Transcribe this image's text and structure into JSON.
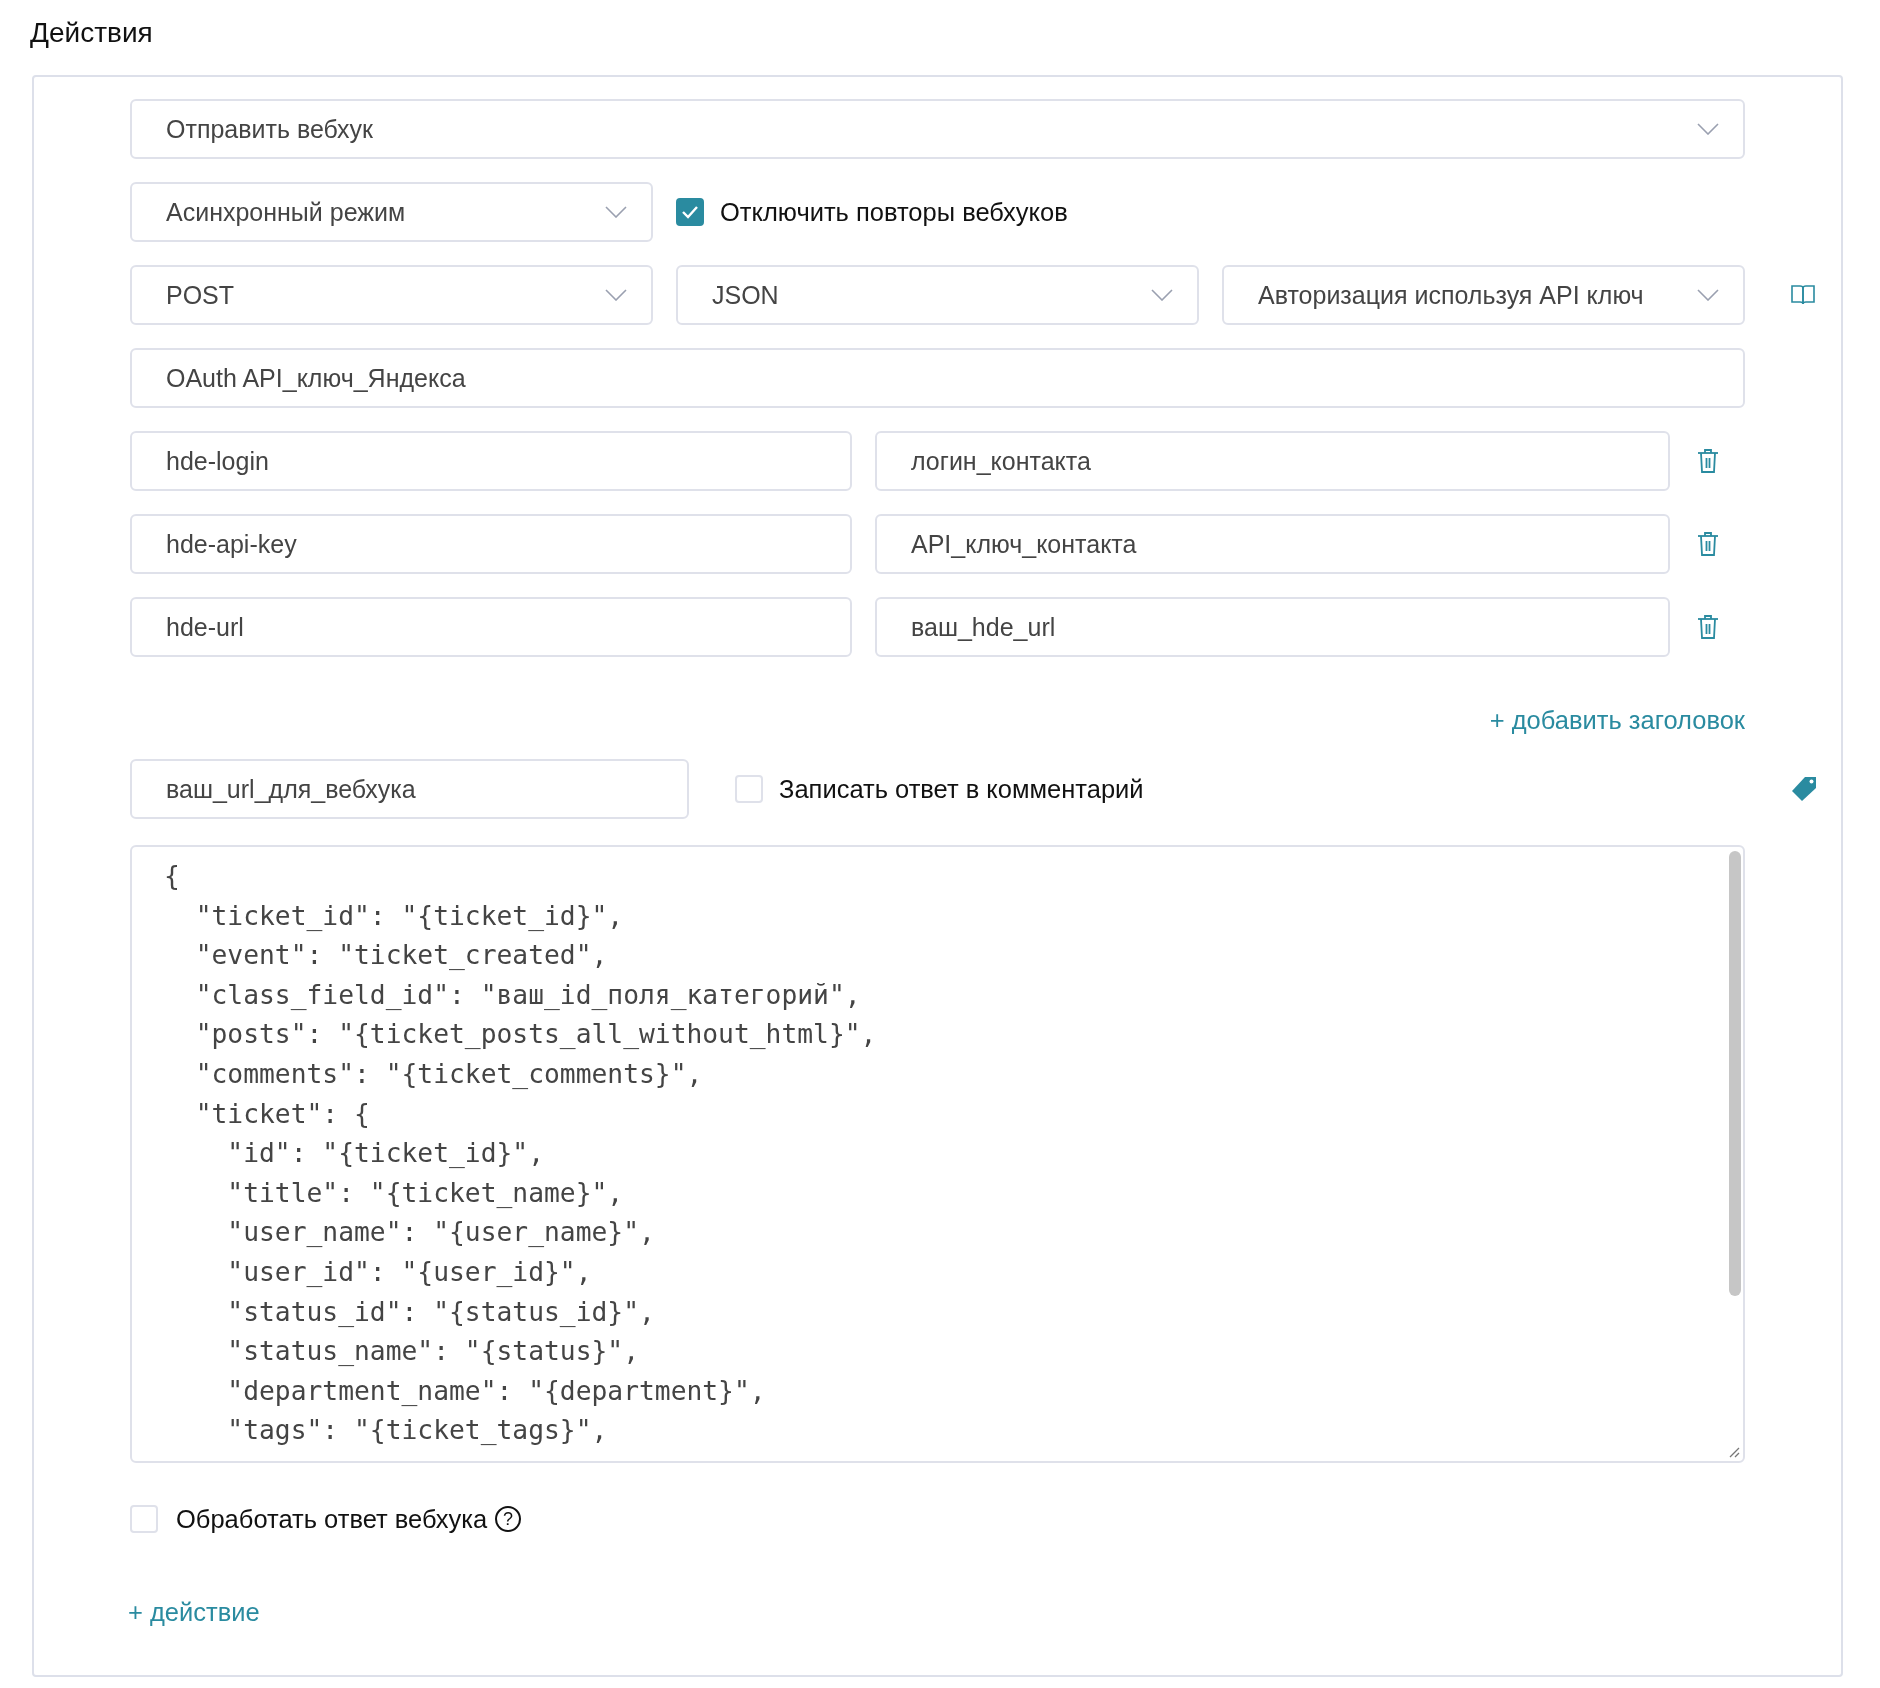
{
  "title": "Действия",
  "action_select": {
    "value": "Отправить вебхук"
  },
  "mode_select": {
    "value": "Асинхронный режим"
  },
  "disable_retries": {
    "label": "Отключить повторы вебхуков",
    "checked": true
  },
  "method_select": {
    "value": "POST"
  },
  "format_select": {
    "value": "JSON"
  },
  "auth_select": {
    "value": "Авторизация используя API ключ"
  },
  "api_key_field": {
    "value": "OAuth API_ключ_Яндекса"
  },
  "headers": [
    {
      "name": "hde-login",
      "value": "логин_контакта"
    },
    {
      "name": "hde-api-key",
      "value": "API_ключ_контакта"
    },
    {
      "name": "hde-url",
      "value": "ваш_hde_url"
    }
  ],
  "add_header_link": "+ добавить заголовок",
  "url_field": {
    "value": "ваш_url_для_вебхука"
  },
  "write_response": {
    "label": "Записать ответ в комментарий",
    "checked": false
  },
  "body_editor": {
    "value": "{\n  \"ticket_id\": \"{ticket_id}\",\n  \"event\": \"ticket_created\",\n  \"class_field_id\": \"ваш_id_поля_категорий\",\n  \"posts\": \"{ticket_posts_all_without_html}\",\n  \"comments\": \"{ticket_comments}\",\n  \"ticket\": {\n    \"id\": \"{ticket_id}\",\n    \"title\": \"{ticket_name}\",\n    \"user_name\": \"{user_name}\",\n    \"user_id\": \"{user_id}\",\n    \"status_id\": \"{status_id}\",\n    \"status_name\": \"{status}\",\n    \"department_name\": \"{department}\",\n    \"tags\": \"{ticket_tags}\","
  },
  "process_response": {
    "label": "Обработать ответ вебхука",
    "checked": false,
    "help": "?"
  },
  "add_action_link": "+ действие"
}
